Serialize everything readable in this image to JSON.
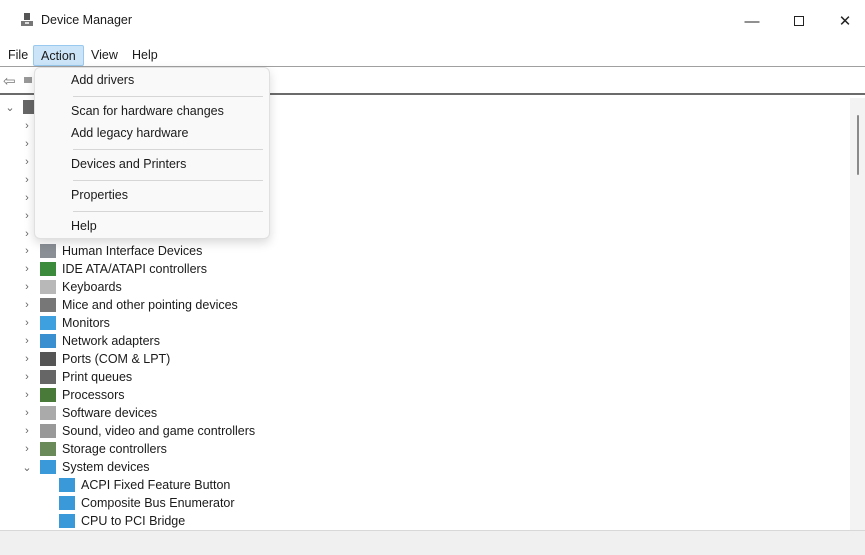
{
  "window": {
    "title": "Device Manager",
    "controls": [
      "minimize",
      "maximize",
      "close"
    ]
  },
  "menubar": [
    "File",
    "Action",
    "View",
    "Help"
  ],
  "action_menu": {
    "items": [
      "Add drivers",
      "Scan for hardware changes",
      "Add legacy hardware",
      "Devices and Printers",
      "Properties",
      "Help"
    ]
  },
  "tree": {
    "categories": [
      {
        "label": "Human Interface Devices",
        "icon": "hid-icon"
      },
      {
        "label": "IDE ATA/ATAPI controllers",
        "icon": "ide-icon"
      },
      {
        "label": "Keyboards",
        "icon": "keyboard-icon"
      },
      {
        "label": "Mice and other pointing devices",
        "icon": "mouse-icon"
      },
      {
        "label": "Monitors",
        "icon": "monitor-icon"
      },
      {
        "label": "Network adapters",
        "icon": "network-icon"
      },
      {
        "label": "Ports (COM & LPT)",
        "icon": "port-icon"
      },
      {
        "label": "Print queues",
        "icon": "printer-icon"
      },
      {
        "label": "Processors",
        "icon": "processor-icon"
      },
      {
        "label": "Software devices",
        "icon": "software-icon"
      },
      {
        "label": "Sound, video and game controllers",
        "icon": "speaker-icon"
      },
      {
        "label": "Storage controllers",
        "icon": "storage-icon"
      },
      {
        "label": "System devices",
        "icon": "system-folder-icon",
        "expanded": true
      }
    ],
    "system_children": [
      "ACPI Fixed Feature Button",
      "Composite Bus Enumerator",
      "CPU to PCI Bridge"
    ]
  }
}
